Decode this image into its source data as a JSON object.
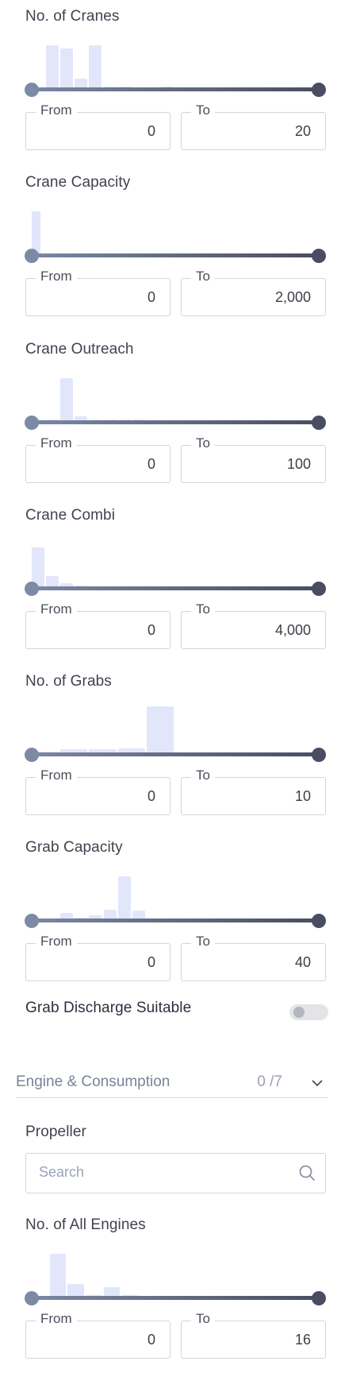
{
  "filters": [
    {
      "label": "No. of Cranes",
      "from_label": "From",
      "to_label": "To",
      "from_value": "0",
      "to_value": "20",
      "range_min": 0,
      "range_max": 20,
      "histogram": [
        0,
        0.92,
        0.85,
        0.22,
        0.92,
        0.05,
        0.05,
        0,
        0,
        0.05,
        0,
        0,
        0,
        0,
        0,
        0,
        0,
        0,
        0,
        0
      ]
    },
    {
      "label": "Crane Capacity",
      "from_label": "From",
      "to_label": "To",
      "from_value": "0",
      "to_value": "2,000",
      "range_min": 0,
      "range_max": 2000,
      "histogram": [
        0.92,
        0,
        0,
        0,
        0,
        0,
        0,
        0,
        0,
        0,
        0,
        0,
        0,
        0,
        0,
        0,
        0,
        0,
        0,
        0,
        0,
        0,
        0,
        0,
        0,
        0,
        0
      ]
    },
    {
      "label": "Crane Outreach",
      "from_label": "From",
      "to_label": "To",
      "from_value": "0",
      "to_value": "100",
      "range_min": 0,
      "range_max": 100,
      "histogram": [
        0.05,
        0.05,
        0.92,
        0.12,
        0.05,
        0.05,
        0.05,
        0.05,
        0,
        0,
        0,
        0,
        0,
        0,
        0,
        0,
        0,
        0,
        0,
        0
      ]
    },
    {
      "label": "Crane Combi",
      "from_label": "From",
      "to_label": "To",
      "from_value": "0",
      "to_value": "4,000",
      "range_min": 0,
      "range_max": 4000,
      "histogram": [
        0.85,
        0.25,
        0.1,
        0.05,
        0,
        0,
        0,
        0,
        0,
        0,
        0,
        0,
        0,
        0,
        0,
        0,
        0,
        0,
        0,
        0
      ]
    },
    {
      "label": "No. of Grabs",
      "from_label": "From",
      "to_label": "To",
      "from_value": "0",
      "to_value": "10",
      "range_min": 0,
      "range_max": 10,
      "histogram": [
        0.05,
        0.1,
        0.1,
        0.12,
        1.0,
        0.03,
        0.03,
        0,
        0,
        0
      ]
    },
    {
      "label": "Grab Capacity",
      "from_label": "From",
      "to_label": "To",
      "from_value": "0",
      "to_value": "40",
      "range_min": 0,
      "range_max": 40,
      "histogram": [
        0,
        0,
        0.15,
        0.05,
        0.1,
        0.22,
        0.92,
        0.2,
        0,
        0,
        0,
        0.02,
        0,
        0,
        0.02,
        0,
        0,
        0,
        0,
        0
      ]
    }
  ],
  "grab_discharge": {
    "label": "Grab Discharge Suitable",
    "enabled": false
  },
  "section": {
    "title": "Engine & Consumption",
    "count": "0 /7"
  },
  "propeller": {
    "label": "Propeller",
    "placeholder": "Search"
  },
  "engines": {
    "label": "No. of All Engines",
    "from_label": "From",
    "to_label": "To",
    "from_value": "0",
    "to_value": "16",
    "range_min": 0,
    "range_max": 16,
    "histogram": [
      0,
      0.92,
      0.28,
      0.05,
      0.22,
      0.05,
      0.03,
      0,
      0,
      0,
      0,
      0,
      0,
      0,
      0,
      0
    ]
  },
  "icons": {
    "search": "search-icon",
    "chevron": "chevron-down-icon"
  },
  "colors": {
    "track_start": "#7b88a3",
    "track_end": "#4a4d62",
    "histogram_bar": "#e2e6fb"
  }
}
